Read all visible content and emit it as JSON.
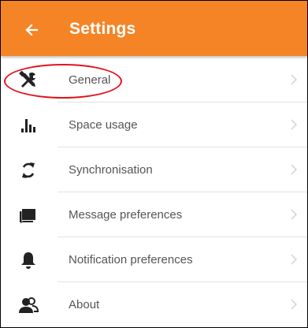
{
  "header": {
    "title": "Settings",
    "back_icon": "arrow-left-icon",
    "background_color": "#f58426",
    "title_color": "#ffffff"
  },
  "settings": {
    "items": [
      {
        "label": "General",
        "icon": "tools-icon"
      },
      {
        "label": "Space usage",
        "icon": "bar-chart-icon"
      },
      {
        "label": "Synchronisation",
        "icon": "sync-icon"
      },
      {
        "label": "Message preferences",
        "icon": "message-icon"
      },
      {
        "label": "Notification preferences",
        "icon": "bell-icon"
      },
      {
        "label": "About",
        "icon": "people-icon"
      }
    ],
    "chevron_icon": "chevron-right-icon"
  },
  "annotation": {
    "highlight_color": "#e0141b"
  }
}
